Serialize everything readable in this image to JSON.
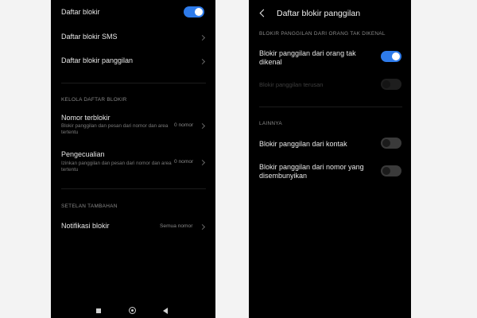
{
  "left": {
    "block_list": {
      "label": "Daftar blokir",
      "enabled": true
    },
    "sms_block_list": {
      "label": "Daftar blokir SMS"
    },
    "call_block_list": {
      "label": "Daftar blokir panggilan"
    },
    "manage_section": {
      "title": "KELOLA DAFTAR BLOKIR"
    },
    "blocked_numbers": {
      "label": "Nomor terblokir",
      "description": "Blokir panggilan dan pesan dari nomor dan area tertentu",
      "value": "0 nomor"
    },
    "exceptions": {
      "label": "Pengecualian",
      "description": "Izinkan panggilan dan pesan dari nomor dan area tertentu",
      "value": "0 nomor"
    },
    "extra_section": {
      "title": "SETELAN TAMBAHAN"
    },
    "block_notifications": {
      "label": "Notifikasi blokir",
      "value": "Semua nomor"
    }
  },
  "right": {
    "header": {
      "title": "Daftar blokir panggilan"
    },
    "unknown_section": {
      "title": "BLOKIR PANGGILAN DARI ORANG TAK DIKENAL"
    },
    "block_unknown": {
      "label": "Blokir panggilan dari orang tak dikenal",
      "enabled": true
    },
    "block_forwarded": {
      "label": "Blokir panggilan terusan",
      "enabled": false,
      "disabled": true
    },
    "other_section": {
      "title": "LAINNYA"
    },
    "block_contacts": {
      "label": "Blokir panggilan dari kontak",
      "enabled": false
    },
    "block_hidden": {
      "label": "Blokir panggilan dari nomor yang disembunyikan",
      "enabled": false
    }
  },
  "colors": {
    "accent": "#2e7bea",
    "background": "#000000",
    "page": "#f3f3f3"
  }
}
